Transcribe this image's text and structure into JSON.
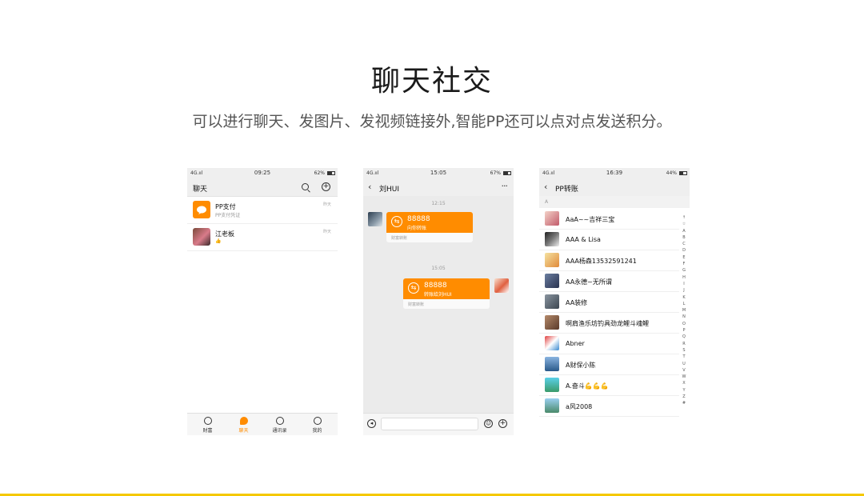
{
  "header": {
    "title": "聊天社交",
    "subtitle": "可以进行聊天、发图片、发视频链接外,智能PP还可以点对点发送积分。"
  },
  "phone1": {
    "status": {
      "signal": "4G.ııl",
      "time": "09:25",
      "battery": "62%"
    },
    "nav_title": "聊天",
    "conversations": [
      {
        "name": "PP支付",
        "preview": "PP支付凭证",
        "time": "昨天"
      },
      {
        "name": "江老板",
        "preview": "👍",
        "time": "昨天"
      }
    ],
    "tabs": [
      {
        "label": "财富"
      },
      {
        "label": "聊天"
      },
      {
        "label": "通讯录"
      },
      {
        "label": "我的"
      }
    ]
  },
  "phone2": {
    "status": {
      "signal": "4G.ııl",
      "time": "15:05",
      "battery": "67%"
    },
    "nav_title": "刘HUI",
    "messages": [
      {
        "time": "12:15",
        "amount": "88888",
        "label": "向你转账",
        "footer": "财富转账"
      },
      {
        "time": "15:05",
        "amount": "88888",
        "label": "转账给刘HUI",
        "footer": "财富转账"
      }
    ]
  },
  "phone3": {
    "status": {
      "signal": "4G.ııl",
      "time": "16:39",
      "battery": "44%"
    },
    "nav_title": "PP转账",
    "section": "A",
    "contacts": [
      "AaA~~吉祥三宝",
      "AAA & Lisa",
      "AAA杨森13532591241",
      "AA永德~无所谓",
      "AA装修",
      "啊肩渔乐坊钓具劲龙鲤斗魂鲤",
      "Abner",
      "A财保小陈",
      "A.奋斗💪💪💪",
      "a风2008"
    ],
    "index": [
      "↑",
      "☆",
      "A",
      "B",
      "C",
      "D",
      "E",
      "F",
      "G",
      "H",
      "I",
      "J",
      "K",
      "L",
      "M",
      "N",
      "O",
      "P",
      "Q",
      "R",
      "S",
      "T",
      "U",
      "V",
      "W",
      "X",
      "Y",
      "Z",
      "#"
    ]
  },
  "colors": {
    "accent": "#ff8c00",
    "bottom_line": "#f5c800"
  }
}
